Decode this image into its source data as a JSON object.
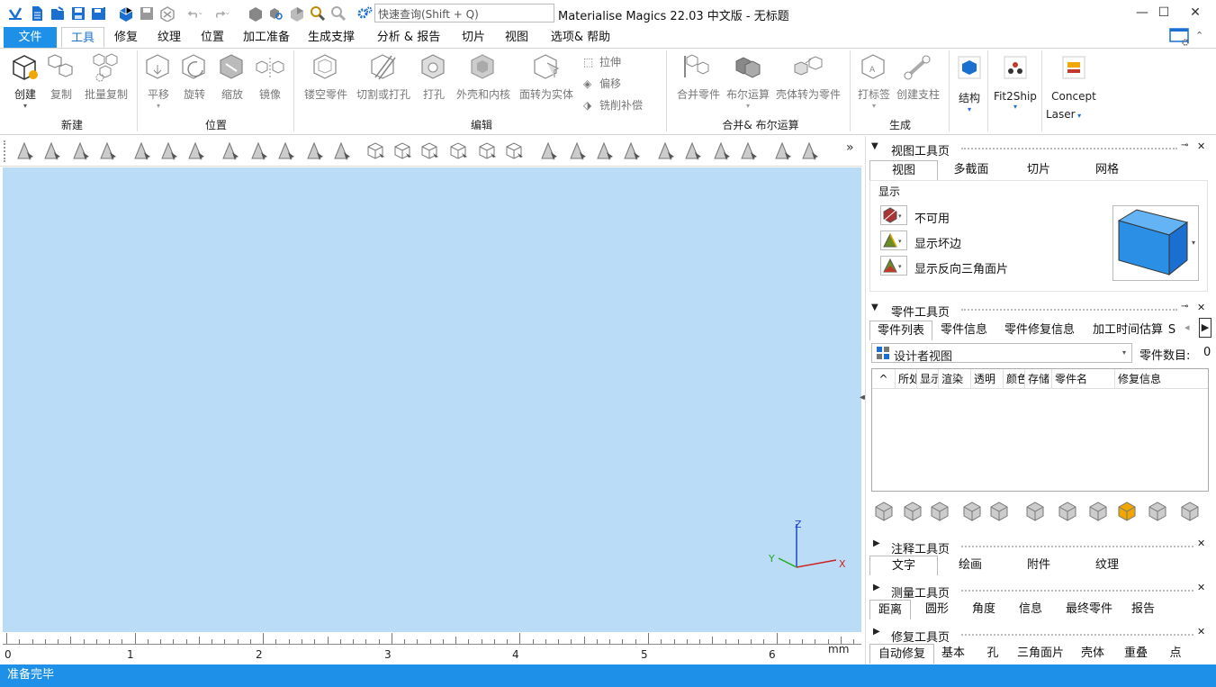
{
  "app": {
    "title": "Materialise Magics 22.03 中文版 - 无标题",
    "search_placeholder": "快速查询(Shift + Q)"
  },
  "window_controls": {
    "minimize": "—",
    "maximize": "☐",
    "close": "✕"
  },
  "tabs": [
    {
      "label": "文件"
    },
    {
      "label": "工具"
    },
    {
      "label": "修复"
    },
    {
      "label": "纹理"
    },
    {
      "label": "位置"
    },
    {
      "label": "加工准备"
    },
    {
      "label": "生成支撑"
    },
    {
      "label": "分析 & 报告"
    },
    {
      "label": "切片"
    },
    {
      "label": "视图"
    },
    {
      "label": "选项& 帮助"
    }
  ],
  "ribbon": {
    "new_group": {
      "label": "新建",
      "create": "创建",
      "copy": "复制",
      "batch_copy": "批量复制"
    },
    "position_group": {
      "label": "位置",
      "translate": "平移",
      "rotate": "旋转",
      "scale": "缩放",
      "mirror": "镜像"
    },
    "edit_group": {
      "label": "编辑",
      "hollow": "镂空零件",
      "cut": "切割或打孔",
      "punch": "打孔",
      "shell": "外壳和内核",
      "surface_solid": "面转为实体",
      "extrude": "拉伸",
      "offset": "偏移",
      "mill": "铣削补偿"
    },
    "merge_group": {
      "label": "合并& 布尔运算",
      "merge": "合并零件",
      "boolean": "布尔运算",
      "shell_part": "壳体转为零件"
    },
    "generate_group": {
      "label": "生成",
      "label_btn": "打标签",
      "support": "创建支柱"
    },
    "structure": "结构",
    "fit2ship": "Fit2Ship",
    "concept": "Concept",
    "laser": "Laser"
  },
  "viewport": {
    "axis_z": "Z",
    "axis_y": "Y",
    "axis_x": "X",
    "ruler_ticks": [
      "0",
      "1",
      "2",
      "3",
      "4",
      "5",
      "6"
    ],
    "unit": "mm"
  },
  "status_text": "准备完毕",
  "view_panel": {
    "title": "视图工具页",
    "tabs": [
      "视图",
      "多截面",
      "切片",
      "网格"
    ],
    "section": "显示",
    "rows": [
      "不可用",
      "显示坏边",
      "显示反向三角面片"
    ]
  },
  "part_panel": {
    "title": "零件工具页",
    "tabs": [
      "零件列表",
      "零件信息",
      "零件修复信息",
      "加工时间估算",
      "S"
    ],
    "view_select": "设计者视图",
    "count_label": "零件数目:",
    "count_value": "0",
    "columns": [
      "^",
      "所处",
      "显示",
      "渲染",
      "透明",
      "颜色",
      "存储",
      "零件名",
      "修复信息"
    ]
  },
  "annotation_panel": {
    "title": "注释工具页",
    "tabs": [
      "文字",
      "绘画",
      "附件",
      "纹理"
    ]
  },
  "measure_panel": {
    "title": "测量工具页",
    "tabs": [
      "距离",
      "圆形",
      "角度",
      "信息",
      "最终零件",
      "报告"
    ]
  },
  "repair_panel": {
    "title": "修复工具页",
    "tabs": [
      "自动修复",
      "基本",
      "孔",
      "三角面片",
      "壳体",
      "重叠",
      "点"
    ]
  },
  "colors": {
    "accent": "#1e90e8",
    "viewport": "#bbdcf6",
    "cube": "#2b8fe6"
  }
}
